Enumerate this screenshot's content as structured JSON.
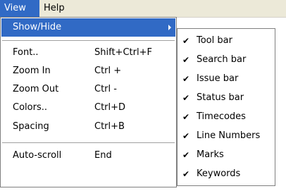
{
  "menubar": {
    "items": [
      {
        "label": "View"
      },
      {
        "label": "Help"
      }
    ]
  },
  "view_menu": {
    "items": [
      {
        "label": "Show/Hide",
        "shortcut": ""
      },
      {
        "label": "Font..",
        "shortcut": "Shift+Ctrl+F"
      },
      {
        "label": "Zoom In",
        "shortcut": "Ctrl +"
      },
      {
        "label": "Zoom Out",
        "shortcut": "Ctrl -"
      },
      {
        "label": "Colors..",
        "shortcut": "Ctrl+D"
      },
      {
        "label": "Spacing",
        "shortcut": "Ctrl+B"
      },
      {
        "label": "Auto-scroll",
        "shortcut": "End"
      }
    ]
  },
  "showhide_menu": {
    "check_glyph": "✔",
    "items": [
      {
        "label": "Tool bar",
        "checked": true
      },
      {
        "label": "Search bar",
        "checked": true
      },
      {
        "label": "Issue bar",
        "checked": true
      },
      {
        "label": "Status bar",
        "checked": true
      },
      {
        "label": "Timecodes",
        "checked": true
      },
      {
        "label": "Line Numbers",
        "checked": true
      },
      {
        "label": "Marks",
        "checked": true
      },
      {
        "label": "Keywords",
        "checked": true
      }
    ]
  },
  "colors": {
    "highlight": "#316ac5",
    "menubar_bg": "#ece9d8"
  }
}
